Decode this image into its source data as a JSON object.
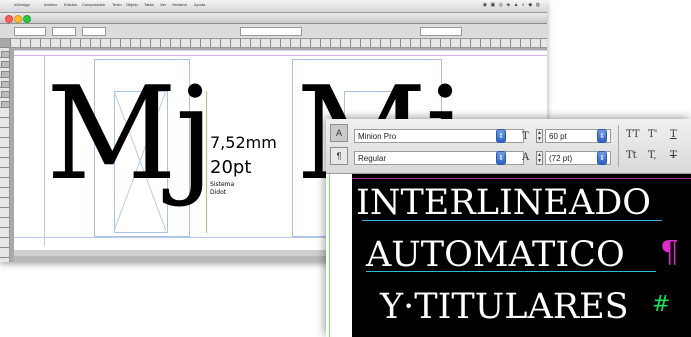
{
  "doc_window": {
    "menu": [
      "InDesign",
      "Archivo",
      "Edición",
      "Composición",
      "Texto",
      "Objeto",
      "Tabla",
      "Ver",
      "Ventana",
      "Ayuda"
    ],
    "glyph_left": "Mj",
    "glyph_right": "Mj",
    "measure_mm": "7,52mm",
    "measure_pt": "20pt",
    "font_line1": "Sistema",
    "font_line2": "Didot"
  },
  "character_panel": {
    "font_family": "Minion Pro",
    "font_style": "Regular",
    "font_size": "60 pt",
    "leading": "(72 pt)",
    "char_a_icon": "A",
    "para_icon": "¶",
    "allcaps_icon": "TT",
    "superscript_icon": "T'",
    "underline_icon": "T",
    "smallcaps_icon": "Tt",
    "subscript_icon": "T,",
    "strike_icon": "T"
  },
  "sample_text": {
    "line1": "INTERLINEADO",
    "line2": "AUTOMATICO",
    "line3": "Y·TITULARES",
    "para_mark": "¶",
    "end_mark": "#"
  },
  "colors": {
    "leading_guide": "#a52aa5",
    "baseline": "#2fb8d8",
    "frame_edge": "#8fe07a"
  }
}
